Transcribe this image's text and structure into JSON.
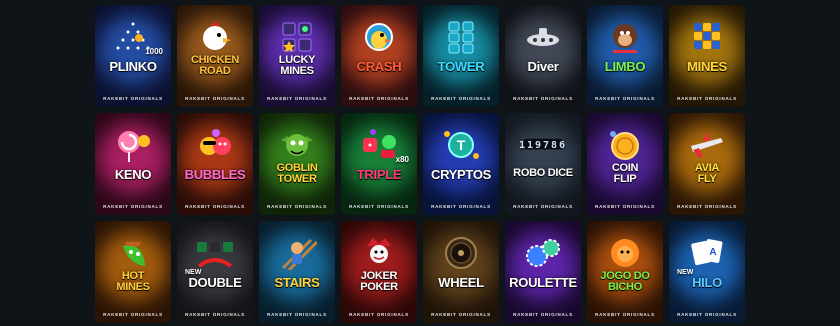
{
  "footer_label": "RAKEBIT ORIGINALS",
  "games": [
    {
      "title": "PLINKO",
      "badge": "1000",
      "title_color": "#ffffff",
      "bg": "#0c1130",
      "glow": "#2858b8",
      "icon": "plinko-icon"
    },
    {
      "title": "CHICKEN\nROAD",
      "badge": "",
      "title_color": "#ffc23a",
      "bg": "#2a1608",
      "glow": "#a86420",
      "icon": "chicken-icon"
    },
    {
      "title": "LUCKY\nMINES",
      "badge": "",
      "title_color": "#ffffff",
      "bg": "#1a0d33",
      "glow": "#6a34c4",
      "icon": "gem-blocks-icon"
    },
    {
      "title": "CRASH",
      "badge": "",
      "title_color": "#ff5b3a",
      "bg": "#2c0d10",
      "glow": "#c84a24",
      "icon": "rocket-bird-icon"
    },
    {
      "title": "TOWER",
      "badge": "",
      "title_color": "#40d8ff",
      "bg": "#061f28",
      "glow": "#1aa0b8",
      "icon": "tower-icon"
    },
    {
      "title": "Diver",
      "badge": "",
      "title_color": "#ffffff",
      "bg": "#101218",
      "glow": "#4a5260",
      "icon": "submarine-icon"
    },
    {
      "title": "LIMBO",
      "badge": "",
      "title_color": "#7cf04a",
      "bg": "#0a1a30",
      "glow": "#2468c0",
      "icon": "monkey-icon"
    },
    {
      "title": "MINES",
      "badge": "",
      "title_color": "#ffd43a",
      "bg": "#231805",
      "glow": "#b88410",
      "icon": "mines-grid-icon"
    },
    {
      "title": "KENO",
      "badge": "",
      "title_color": "#ffffff",
      "bg": "#2c0818",
      "glow": "#c02470",
      "icon": "lollipop-icon"
    },
    {
      "title": "BUBBLES",
      "badge": "",
      "title_color": "#ff6ad0",
      "bg": "#2a0d08",
      "glow": "#c04018",
      "icon": "bubble-emoji-icon"
    },
    {
      "title": "GOBLIN\nTOWER",
      "badge": "",
      "title_color": "#ffd43a",
      "bg": "#0f2408",
      "glow": "#3a9020",
      "icon": "goblin-icon"
    },
    {
      "title": "TRIPLE",
      "badge": "x80",
      "title_color": "#ff3a7a",
      "bg": "#072510",
      "glow": "#1a9040",
      "icon": "dice-icon"
    },
    {
      "title": "CRYPTOS",
      "badge": "",
      "title_color": "#ffffff",
      "bg": "#08143a",
      "glow": "#2a44c8",
      "icon": "coin-icon"
    },
    {
      "title": "ROBO DICE",
      "badge": "119786",
      "title_color": "#ffffff",
      "bg": "#131820",
      "glow": "#3a4858",
      "icon": "counter-icon"
    },
    {
      "title": "COIN\nFLIP",
      "badge": "",
      "title_color": "#ffffff",
      "bg": "#1a0a30",
      "glow": "#5a2aa8",
      "icon": "flip-coin-icon"
    },
    {
      "title": "AVIA\nFLY",
      "badge": "",
      "title_color": "#ffe23a",
      "bg": "#2a1605",
      "glow": "#c07a10",
      "icon": "plane-icon"
    },
    {
      "title": "HOT\nMINES",
      "badge": "",
      "title_color": "#ffcf3a",
      "bg": "#2a1405",
      "glow": "#b86a10",
      "icon": "chili-icon"
    },
    {
      "title": "DOUBLE",
      "badge": "NEW",
      "title_color": "#ffffff",
      "bg": "#151518",
      "glow": "#404048",
      "icon": "multiplier-icon"
    },
    {
      "title": "STAIRS",
      "badge": "",
      "title_color": "#ffd43a",
      "bg": "#081e2c",
      "glow": "#1c7ab0",
      "icon": "climber-icon"
    },
    {
      "title": "JOKER\nPOKER",
      "badge": "",
      "title_color": "#ffffff",
      "bg": "#2c0808",
      "glow": "#b42020",
      "icon": "joker-icon"
    },
    {
      "title": "WHEEL",
      "badge": "",
      "title_color": "#ffffff",
      "bg": "#1f1408",
      "glow": "#6a4a20",
      "icon": "roulette-wheel-icon"
    },
    {
      "title": "ROULETTE",
      "badge": "",
      "title_color": "#ffffff",
      "bg": "#18092c",
      "glow": "#6a2ac0",
      "icon": "chips-icon"
    },
    {
      "title": "JOGO DO\nBICHO",
      "badge": "",
      "title_color": "#7cf04a",
      "bg": "#2a1205",
      "glow": "#c05a10",
      "icon": "lion-icon"
    },
    {
      "title": "HILO",
      "badge": "NEW",
      "title_color": "#5ac8ff",
      "bg": "#081a34",
      "glow": "#2070c8",
      "icon": "cards-icon"
    }
  ]
}
